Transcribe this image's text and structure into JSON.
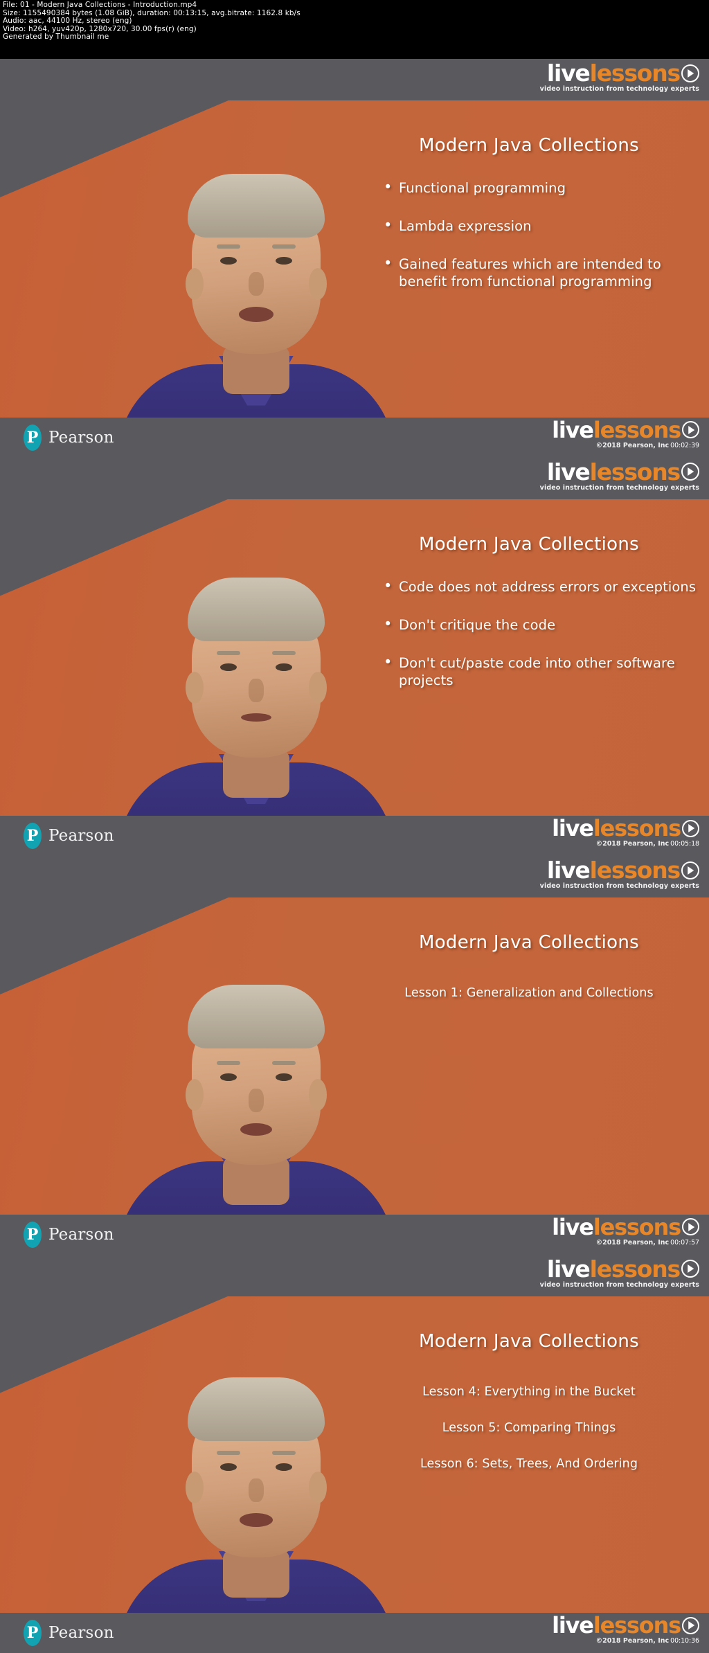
{
  "info_header": {
    "lines": [
      "File: 01 - Modern Java Collections - Introduction.mp4",
      "Size: 1155490384 bytes (1.08 GiB), duration: 00:13:15, avg.bitrate: 1162.8 kb/s",
      "Audio: aac, 44100 Hz, stereo (eng)",
      "Video: h264, yuv420p, 1280x720, 30.00 fps(r) (eng)",
      "Generated by Thumbnail me"
    ]
  },
  "brand": {
    "live": "live",
    "lessons": "lessons",
    "tagline": "video instruction from technology experts",
    "pearson_name": "Pearson",
    "pearson_initial": "P",
    "copyright": "©2018 Pearson, Inc",
    "orange": "#e8862a",
    "teal": "#12a3b3",
    "banner_gray": "#5a595e"
  },
  "frames": [
    {
      "title": "Modern Java Collections",
      "bullets": [
        "Functional programming",
        "Lambda expression",
        "Gained features which are intended to benefit from functional programming"
      ],
      "lessons": [],
      "timestamp": "00:02:39"
    },
    {
      "title": "Modern Java Collections",
      "bullets": [
        "Code does not address errors or exceptions",
        "Don't critique the code",
        "Don't cut/paste code into other software projects"
      ],
      "lessons": [],
      "timestamp": "00:05:18"
    },
    {
      "title": "Modern Java Collections",
      "bullets": [],
      "lessons": [
        "Lesson 1: Generalization and Collections"
      ],
      "timestamp": "00:07:57"
    },
    {
      "title": "Modern Java Collections",
      "bullets": [],
      "lessons": [
        "Lesson 4:  Everything in the Bucket",
        "Lesson 5: Comparing Things",
        "Lesson 6: Sets, Trees, And Ordering"
      ],
      "timestamp": "00:10:36"
    }
  ]
}
